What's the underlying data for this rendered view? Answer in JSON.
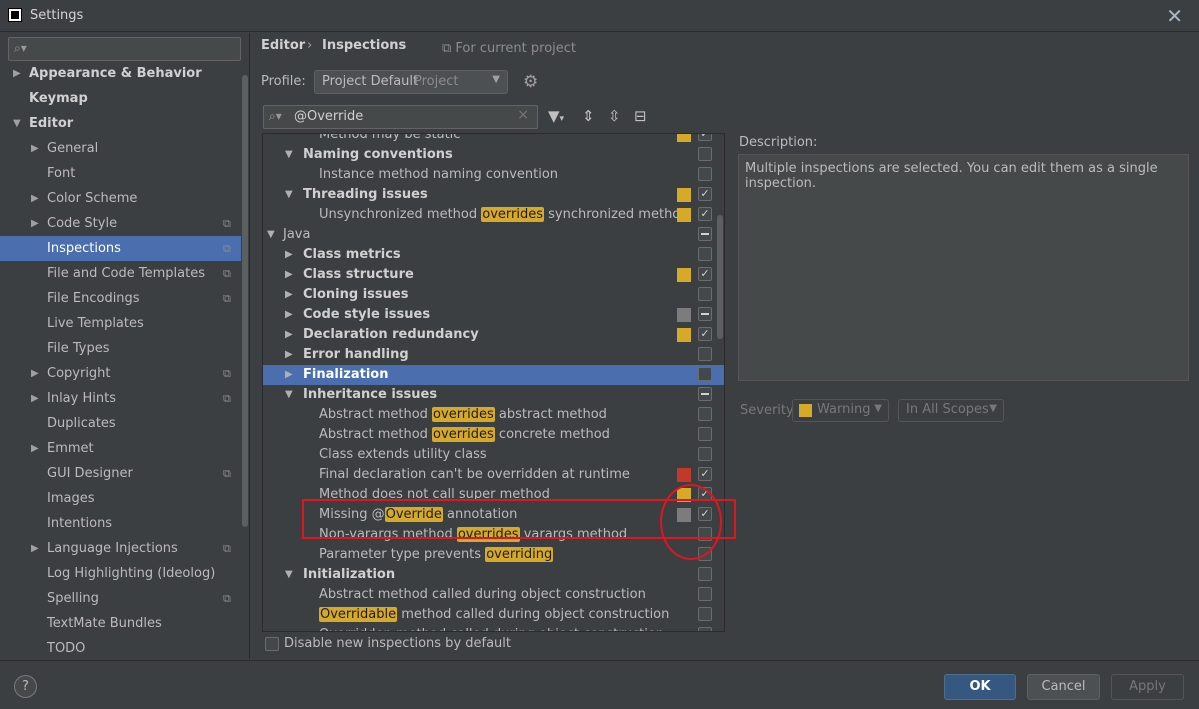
{
  "window": {
    "title": "Settings"
  },
  "sidebar": {
    "search_placeholder": "",
    "items": [
      {
        "label": "Appearance & Behavior",
        "level": 0,
        "arrow": "right",
        "bold": true
      },
      {
        "label": "Keymap",
        "level": 0,
        "arrow": "",
        "bold": true
      },
      {
        "label": "Editor",
        "level": 0,
        "arrow": "down",
        "bold": true
      },
      {
        "label": "General",
        "level": 1,
        "arrow": "right"
      },
      {
        "label": "Font",
        "level": 1,
        "arrow": ""
      },
      {
        "label": "Color Scheme",
        "level": 1,
        "arrow": "right"
      },
      {
        "label": "Code Style",
        "level": 1,
        "arrow": "right",
        "project": true
      },
      {
        "label": "Inspections",
        "level": 1,
        "arrow": "",
        "project": true,
        "selected": true
      },
      {
        "label": "File and Code Templates",
        "level": 1,
        "arrow": "",
        "project": true
      },
      {
        "label": "File Encodings",
        "level": 1,
        "arrow": "",
        "project": true
      },
      {
        "label": "Live Templates",
        "level": 1,
        "arrow": ""
      },
      {
        "label": "File Types",
        "level": 1,
        "arrow": ""
      },
      {
        "label": "Copyright",
        "level": 1,
        "arrow": "right",
        "project": true
      },
      {
        "label": "Inlay Hints",
        "level": 1,
        "arrow": "right",
        "project": true
      },
      {
        "label": "Duplicates",
        "level": 1,
        "arrow": ""
      },
      {
        "label": "Emmet",
        "level": 1,
        "arrow": "right"
      },
      {
        "label": "GUI Designer",
        "level": 1,
        "arrow": "",
        "project": true
      },
      {
        "label": "Images",
        "level": 1,
        "arrow": ""
      },
      {
        "label": "Intentions",
        "level": 1,
        "arrow": ""
      },
      {
        "label": "Language Injections",
        "level": 1,
        "arrow": "right",
        "project": true
      },
      {
        "label": "Log Highlighting (Ideolog)",
        "level": 1,
        "arrow": ""
      },
      {
        "label": "Spelling",
        "level": 1,
        "arrow": "",
        "project": true
      },
      {
        "label": "TextMate Bundles",
        "level": 1,
        "arrow": ""
      },
      {
        "label": "TODO",
        "level": 1,
        "arrow": ""
      }
    ]
  },
  "header": {
    "crumb_editor": "Editor",
    "crumb_sep": "›",
    "crumb_inspections": "Inspections",
    "for_project": "For current project",
    "profile_label": "Profile:",
    "profile_value": "Project Default",
    "profile_scope": "Project"
  },
  "search": {
    "value": "@Override"
  },
  "icons": {
    "search": "search-icon",
    "gear": "gear-icon",
    "filter": "filter-icon",
    "expand_all": "expand-all-icon",
    "collapse_all": "collapse-all-icon",
    "reset": "reset-icon",
    "project": "project-scope-icon"
  },
  "colors": {
    "warning": "#d6a928",
    "error": "#c0392b",
    "weak": "#7c7c7c",
    "selection": "#4b6eaf",
    "accent_ok": "#365880",
    "annotation": "#e0151f"
  },
  "inspections": [
    {
      "indent": 2,
      "caret": "",
      "group": false,
      "parts": [
        "Method may be static"
      ],
      "sev": "warning",
      "check": "checked"
    },
    {
      "indent": 1,
      "caret": "down",
      "group": true,
      "parts": [
        "Naming conventions"
      ],
      "sev": "",
      "check": "unchecked"
    },
    {
      "indent": 2,
      "caret": "",
      "group": false,
      "parts": [
        "Instance method naming convention"
      ],
      "sev": "",
      "check": "unchecked"
    },
    {
      "indent": 1,
      "caret": "down",
      "group": true,
      "parts": [
        "Threading issues"
      ],
      "sev": "warning",
      "check": "checked"
    },
    {
      "indent": 2,
      "caret": "",
      "group": false,
      "parts": [
        "Unsynchronized method ",
        "overrides",
        " synchronized method"
      ],
      "sev": "warning",
      "check": "checked"
    },
    {
      "indent": 0,
      "caret": "down",
      "group": false,
      "parts": [
        "Java"
      ],
      "sev": "",
      "check": "mixed"
    },
    {
      "indent": 1,
      "caret": "right",
      "group": true,
      "parts": [
        "Class metrics"
      ],
      "sev": "",
      "check": "unchecked"
    },
    {
      "indent": 1,
      "caret": "right",
      "group": true,
      "parts": [
        "Class structure"
      ],
      "sev": "warning",
      "check": "checked"
    },
    {
      "indent": 1,
      "caret": "right",
      "group": true,
      "parts": [
        "Cloning issues"
      ],
      "sev": "",
      "check": "unchecked"
    },
    {
      "indent": 1,
      "caret": "right",
      "group": true,
      "parts": [
        "Code style issues"
      ],
      "sev": "weak",
      "check": "mixed"
    },
    {
      "indent": 1,
      "caret": "right",
      "group": true,
      "parts": [
        "Declaration redundancy"
      ],
      "sev": "warning",
      "check": "checked"
    },
    {
      "indent": 1,
      "caret": "right",
      "group": true,
      "parts": [
        "Error handling"
      ],
      "sev": "",
      "check": "unchecked"
    },
    {
      "indent": 1,
      "caret": "right",
      "group": true,
      "parts": [
        "Finalization"
      ],
      "sev": "",
      "check": "unchecked",
      "selected": true
    },
    {
      "indent": 1,
      "caret": "down",
      "group": true,
      "parts": [
        "Inheritance issues"
      ],
      "sev": "",
      "check": "mixed"
    },
    {
      "indent": 2,
      "caret": "",
      "group": false,
      "parts": [
        "Abstract method ",
        "overrides",
        " abstract method"
      ],
      "sev": "",
      "check": "unchecked"
    },
    {
      "indent": 2,
      "caret": "",
      "group": false,
      "parts": [
        "Abstract method ",
        "overrides",
        " concrete method"
      ],
      "sev": "",
      "check": "unchecked"
    },
    {
      "indent": 2,
      "caret": "",
      "group": false,
      "parts": [
        "Class extends utility class"
      ],
      "sev": "",
      "check": "unchecked"
    },
    {
      "indent": 2,
      "caret": "",
      "group": false,
      "parts": [
        "Final declaration can't be overridden at runtime"
      ],
      "sev": "error",
      "check": "checked"
    },
    {
      "indent": 2,
      "caret": "",
      "group": false,
      "parts": [
        "Method does not call super method"
      ],
      "sev": "warning",
      "check": "checked"
    },
    {
      "indent": 2,
      "caret": "",
      "group": false,
      "parts": [
        "Missing @",
        "Override",
        " annotation"
      ],
      "sev": "weak",
      "check": "checked"
    },
    {
      "indent": 2,
      "caret": "",
      "group": false,
      "parts": [
        "Non-varargs method ",
        "overrides",
        " varargs method"
      ],
      "sev": "",
      "check": "unchecked"
    },
    {
      "indent": 2,
      "caret": "",
      "group": false,
      "parts": [
        "Parameter type prevents ",
        "overriding"
      ],
      "sev": "",
      "check": "unchecked"
    },
    {
      "indent": 1,
      "caret": "down",
      "group": true,
      "parts": [
        "Initialization"
      ],
      "sev": "",
      "check": "unchecked"
    },
    {
      "indent": 2,
      "caret": "",
      "group": false,
      "parts": [
        "Abstract method called during object construction"
      ],
      "sev": "",
      "check": "unchecked"
    },
    {
      "indent": 2,
      "caret": "",
      "group": false,
      "parts": [
        "",
        "Overridable",
        " method called during object construction"
      ],
      "sev": "",
      "check": "unchecked"
    },
    {
      "indent": 2,
      "caret": "",
      "group": false,
      "parts": [
        "Overridden method called during object construction"
      ],
      "sev": "",
      "check": "unchecked"
    }
  ],
  "bottom_checkbox": {
    "label": "Disable new inspections by default",
    "checked": false
  },
  "description": {
    "label": "Description:",
    "text": "Multiple inspections are selected. You can edit them as a single inspection."
  },
  "severity": {
    "label": "Severity:",
    "value": "Warning",
    "scope": "In All Scopes"
  },
  "buttons": {
    "ok": "OK",
    "cancel": "Cancel",
    "apply": "Apply",
    "help": "?"
  }
}
